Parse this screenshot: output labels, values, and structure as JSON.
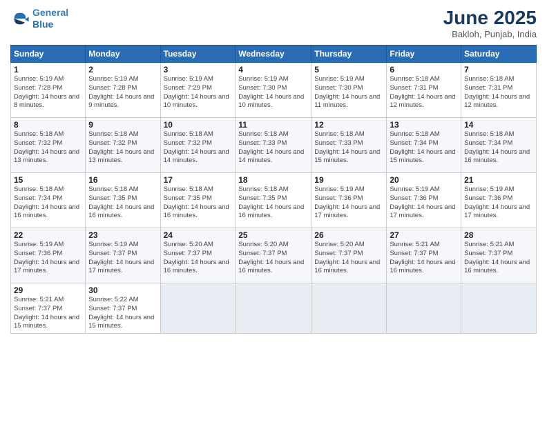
{
  "logo": {
    "line1": "General",
    "line2": "Blue"
  },
  "title": "June 2025",
  "location": "Bakloh, Punjab, India",
  "headers": [
    "Sunday",
    "Monday",
    "Tuesday",
    "Wednesday",
    "Thursday",
    "Friday",
    "Saturday"
  ],
  "weeks": [
    [
      {
        "day": "1",
        "sunrise": "5:19 AM",
        "sunset": "7:28 PM",
        "daylight": "14 hours and 8 minutes."
      },
      {
        "day": "2",
        "sunrise": "5:19 AM",
        "sunset": "7:28 PM",
        "daylight": "14 hours and 9 minutes."
      },
      {
        "day": "3",
        "sunrise": "5:19 AM",
        "sunset": "7:29 PM",
        "daylight": "14 hours and 10 minutes."
      },
      {
        "day": "4",
        "sunrise": "5:19 AM",
        "sunset": "7:30 PM",
        "daylight": "14 hours and 10 minutes."
      },
      {
        "day": "5",
        "sunrise": "5:19 AM",
        "sunset": "7:30 PM",
        "daylight": "14 hours and 11 minutes."
      },
      {
        "day": "6",
        "sunrise": "5:18 AM",
        "sunset": "7:31 PM",
        "daylight": "14 hours and 12 minutes."
      },
      {
        "day": "7",
        "sunrise": "5:18 AM",
        "sunset": "7:31 PM",
        "daylight": "14 hours and 12 minutes."
      }
    ],
    [
      {
        "day": "8",
        "sunrise": "5:18 AM",
        "sunset": "7:32 PM",
        "daylight": "14 hours and 13 minutes."
      },
      {
        "day": "9",
        "sunrise": "5:18 AM",
        "sunset": "7:32 PM",
        "daylight": "14 hours and 13 minutes."
      },
      {
        "day": "10",
        "sunrise": "5:18 AM",
        "sunset": "7:32 PM",
        "daylight": "14 hours and 14 minutes."
      },
      {
        "day": "11",
        "sunrise": "5:18 AM",
        "sunset": "7:33 PM",
        "daylight": "14 hours and 14 minutes."
      },
      {
        "day": "12",
        "sunrise": "5:18 AM",
        "sunset": "7:33 PM",
        "daylight": "14 hours and 15 minutes."
      },
      {
        "day": "13",
        "sunrise": "5:18 AM",
        "sunset": "7:34 PM",
        "daylight": "14 hours and 15 minutes."
      },
      {
        "day": "14",
        "sunrise": "5:18 AM",
        "sunset": "7:34 PM",
        "daylight": "14 hours and 16 minutes."
      }
    ],
    [
      {
        "day": "15",
        "sunrise": "5:18 AM",
        "sunset": "7:34 PM",
        "daylight": "14 hours and 16 minutes."
      },
      {
        "day": "16",
        "sunrise": "5:18 AM",
        "sunset": "7:35 PM",
        "daylight": "14 hours and 16 minutes."
      },
      {
        "day": "17",
        "sunrise": "5:18 AM",
        "sunset": "7:35 PM",
        "daylight": "14 hours and 16 minutes."
      },
      {
        "day": "18",
        "sunrise": "5:18 AM",
        "sunset": "7:35 PM",
        "daylight": "14 hours and 16 minutes."
      },
      {
        "day": "19",
        "sunrise": "5:19 AM",
        "sunset": "7:36 PM",
        "daylight": "14 hours and 17 minutes."
      },
      {
        "day": "20",
        "sunrise": "5:19 AM",
        "sunset": "7:36 PM",
        "daylight": "14 hours and 17 minutes."
      },
      {
        "day": "21",
        "sunrise": "5:19 AM",
        "sunset": "7:36 PM",
        "daylight": "14 hours and 17 minutes."
      }
    ],
    [
      {
        "day": "22",
        "sunrise": "5:19 AM",
        "sunset": "7:36 PM",
        "daylight": "14 hours and 17 minutes."
      },
      {
        "day": "23",
        "sunrise": "5:19 AM",
        "sunset": "7:37 PM",
        "daylight": "14 hours and 17 minutes."
      },
      {
        "day": "24",
        "sunrise": "5:20 AM",
        "sunset": "7:37 PM",
        "daylight": "14 hours and 16 minutes."
      },
      {
        "day": "25",
        "sunrise": "5:20 AM",
        "sunset": "7:37 PM",
        "daylight": "14 hours and 16 minutes."
      },
      {
        "day": "26",
        "sunrise": "5:20 AM",
        "sunset": "7:37 PM",
        "daylight": "14 hours and 16 minutes."
      },
      {
        "day": "27",
        "sunrise": "5:21 AM",
        "sunset": "7:37 PM",
        "daylight": "14 hours and 16 minutes."
      },
      {
        "day": "28",
        "sunrise": "5:21 AM",
        "sunset": "7:37 PM",
        "daylight": "14 hours and 16 minutes."
      }
    ],
    [
      {
        "day": "29",
        "sunrise": "5:21 AM",
        "sunset": "7:37 PM",
        "daylight": "14 hours and 15 minutes."
      },
      {
        "day": "30",
        "sunrise": "5:22 AM",
        "sunset": "7:37 PM",
        "daylight": "14 hours and 15 minutes."
      },
      null,
      null,
      null,
      null,
      null
    ]
  ]
}
